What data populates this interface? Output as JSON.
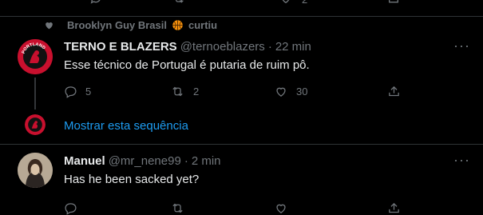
{
  "top_stats": {
    "retweet_count": "",
    "like_count": "2"
  },
  "social_context": {
    "user": "Brooklyn Guy Brasil",
    "action": "curtiu"
  },
  "tweet1": {
    "display_name": "TERNO E BLAZERS",
    "handle": "@ternoeblazers",
    "separator": "·",
    "time": "22 min",
    "text": "Esse técnico de Portugal é putaria de ruim pô.",
    "replies": "5",
    "retweets": "2",
    "likes": "30",
    "avatar_logo_text": "PORTLAND"
  },
  "thread_link": {
    "label": "Mostrar esta sequência"
  },
  "tweet2": {
    "display_name": "Manuel",
    "handle": "@mr_nene99",
    "separator": "·",
    "time": "2 min",
    "text": "Has he been sacked yet?"
  },
  "colors": {
    "background": "#000000",
    "text": "#e7e9ea",
    "muted": "#71767b",
    "link": "#1d9bf0",
    "divider": "#2f3336",
    "logo_red": "#c8102e"
  },
  "icons": [
    "heart-icon",
    "basketball-icon",
    "reply-icon",
    "retweet-icon",
    "like-icon",
    "share-icon",
    "more-icon"
  ]
}
